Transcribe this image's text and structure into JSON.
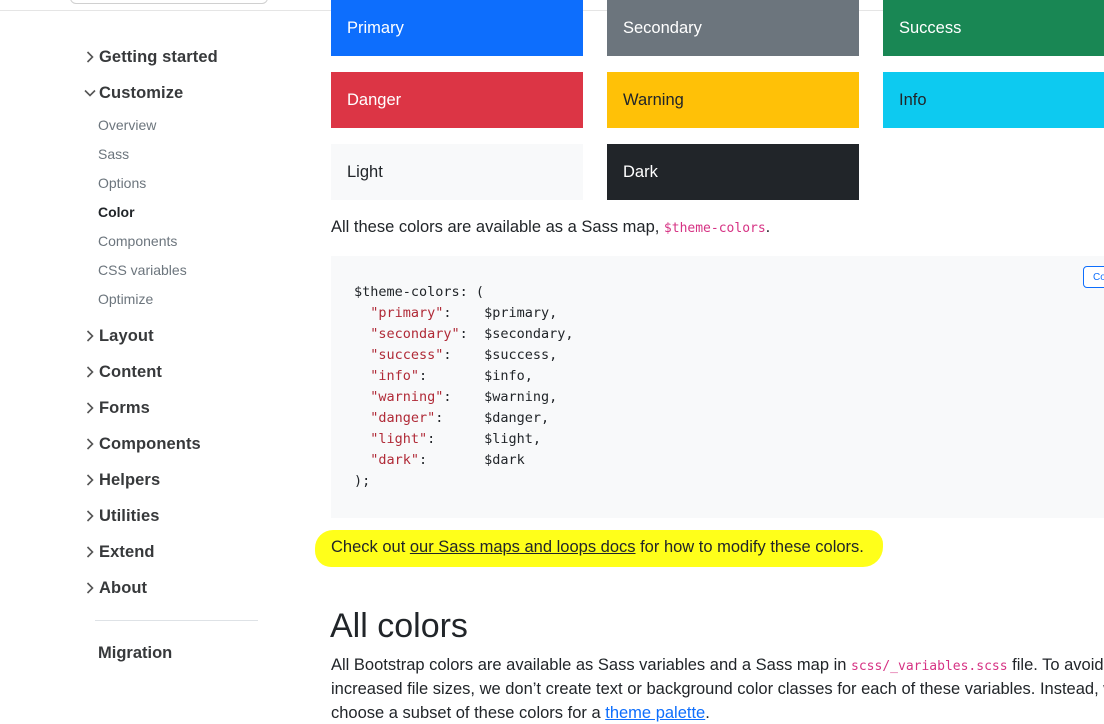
{
  "sidebar": {
    "groups_top": [
      {
        "label": "Getting started",
        "expanded": false
      },
      {
        "label": "Customize",
        "expanded": true
      }
    ],
    "customize_items": [
      {
        "label": "Overview",
        "active": false
      },
      {
        "label": "Sass",
        "active": false
      },
      {
        "label": "Options",
        "active": false
      },
      {
        "label": "Color",
        "active": true
      },
      {
        "label": "Components",
        "active": false
      },
      {
        "label": "CSS variables",
        "active": false
      },
      {
        "label": "Optimize",
        "active": false
      }
    ],
    "groups_bottom": [
      {
        "label": "Layout"
      },
      {
        "label": "Content"
      },
      {
        "label": "Forms"
      },
      {
        "label": "Components"
      },
      {
        "label": "Helpers"
      },
      {
        "label": "Utilities"
      },
      {
        "label": "Extend"
      },
      {
        "label": "About"
      }
    ],
    "migration_label": "Migration"
  },
  "swatches": [
    {
      "label": "Primary",
      "bg": "#0d6efd",
      "fg": "#ffffff"
    },
    {
      "label": "Secondary",
      "bg": "#6c757d",
      "fg": "#ffffff"
    },
    {
      "label": "Success",
      "bg": "#198754",
      "fg": "#ffffff"
    },
    {
      "label": "Danger",
      "bg": "#dc3545",
      "fg": "#ffffff"
    },
    {
      "label": "Warning",
      "bg": "#ffc107",
      "fg": "#212529"
    },
    {
      "label": "Info",
      "bg": "#0dcaf0",
      "fg": "#212529"
    },
    {
      "label": "Light",
      "bg": "#f8f9fa",
      "fg": "#212529"
    },
    {
      "label": "Dark",
      "bg": "#212529",
      "fg": "#ffffff"
    }
  ],
  "sass_map_note": {
    "before": "All these colors are available as a Sass map, ",
    "code": "$theme-colors",
    "after": "."
  },
  "code_block": {
    "copy_label": "Copy",
    "opening": "$theme-colors: (",
    "entries": [
      {
        "key": "\"primary\"",
        "sep": ":    ",
        "value": "$primary,"
      },
      {
        "key": "\"secondary\"",
        "sep": ":  ",
        "value": "$secondary,"
      },
      {
        "key": "\"success\"",
        "sep": ":    ",
        "value": "$success,"
      },
      {
        "key": "\"info\"",
        "sep": ":       ",
        "value": "$info,"
      },
      {
        "key": "\"warning\"",
        "sep": ":    ",
        "value": "$warning,"
      },
      {
        "key": "\"danger\"",
        "sep": ":     ",
        "value": "$danger,"
      },
      {
        "key": "\"light\"",
        "sep": ":      ",
        "value": "$light,"
      },
      {
        "key": "\"dark\"",
        "sep": ":       ",
        "value": "$dark"
      }
    ],
    "closing": ");"
  },
  "check_out": {
    "before": "Check out ",
    "link": "our Sass maps and loops docs",
    "after": " for how to modify these colors."
  },
  "all_colors": {
    "heading": "All colors",
    "line1_before": "All Bootstrap colors are available as Sass variables and a Sass map in ",
    "line1_code": "scss/_variables.scss",
    "line1_after": " file. To avoid",
    "line2": "increased file sizes, we don’t create text or background color classes for each of these variables. Instead, w",
    "line3_before": "choose a subset of these colors for a ",
    "line3_link": "theme palette",
    "line3_after": "."
  },
  "colors": {
    "link_blue": "#0d6efd",
    "highlight": "#ffff1a",
    "code_pink": "#d63384",
    "code_string": "#b02a37"
  }
}
